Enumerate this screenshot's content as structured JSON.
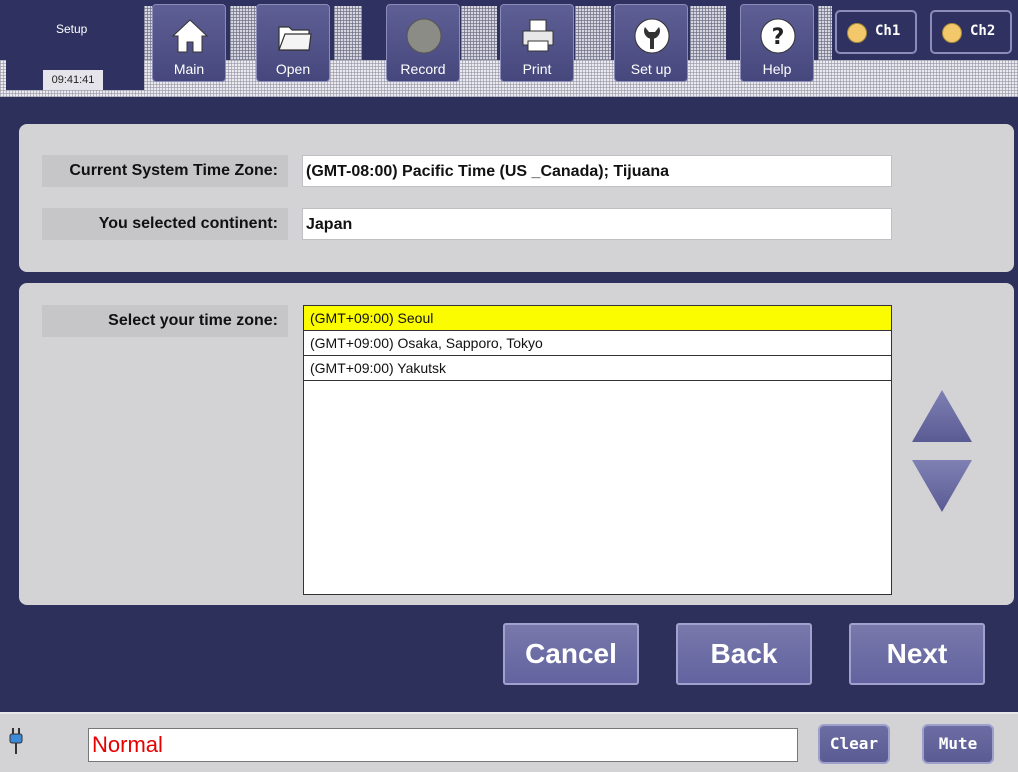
{
  "header": {
    "mode": "Setup",
    "clock": "09:41:41",
    "toolbar": [
      {
        "label": "Main",
        "icon": "home-icon"
      },
      {
        "label": "Open",
        "icon": "folder-icon"
      },
      {
        "label": "Record",
        "icon": "record-icon"
      },
      {
        "label": "Print",
        "icon": "printer-icon"
      },
      {
        "label": "Set up",
        "icon": "wrench-icon"
      },
      {
        "label": "Help",
        "icon": "help-icon"
      }
    ],
    "channels": [
      {
        "label": "Ch1",
        "color": "#f3c86a"
      },
      {
        "label": "Ch2",
        "color": "#f3c86a"
      }
    ]
  },
  "current_zone": {
    "label": "Current System Time Zone:",
    "value": "(GMT-08:00) Pacific Time (US _Canada); Tijuana"
  },
  "continent": {
    "label": "You selected continent:",
    "value": "Japan"
  },
  "zone_select": {
    "label": "Select your time zone:",
    "options": [
      "(GMT+09:00) Seoul",
      "(GMT+09:00) Osaka, Sapporo, Tokyo",
      "(GMT+09:00) Yakutsk"
    ],
    "selected": "(GMT+09:00) Seoul",
    "selected_color": "#fcfc00"
  },
  "nav": {
    "cancel": "Cancel",
    "back": "Back",
    "next": "Next"
  },
  "status": {
    "message": "Normal",
    "message_color": "#e60000",
    "clear": "Clear",
    "mute": "Mute"
  }
}
